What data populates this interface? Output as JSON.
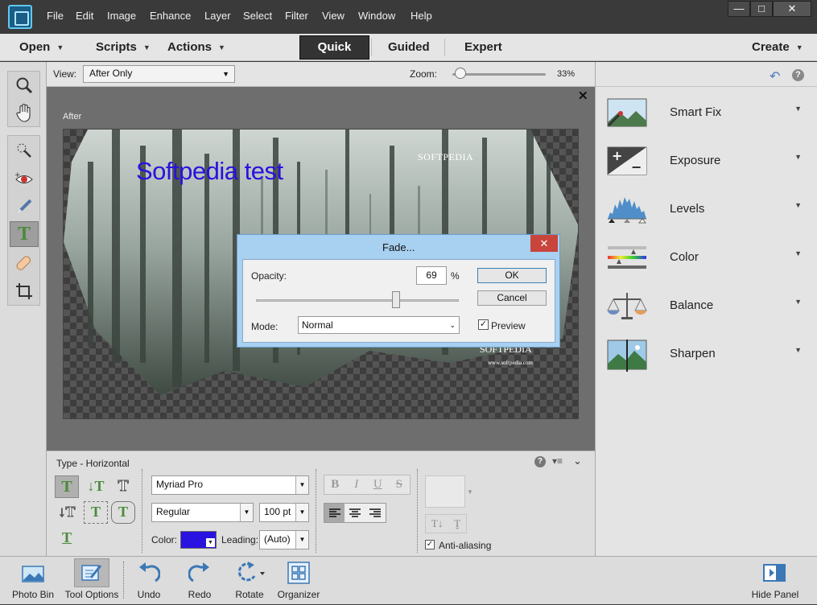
{
  "menu": [
    "File",
    "Edit",
    "Image",
    "Enhance",
    "Layer",
    "Select",
    "Filter",
    "View",
    "Window",
    "Help"
  ],
  "window_controls": {
    "minimize": "—",
    "maximize": "□",
    "close": "✕"
  },
  "modebar": {
    "open": "Open",
    "scripts": "Scripts",
    "actions": "Actions",
    "quick": "Quick",
    "guided": "Guided",
    "expert": "Expert",
    "create": "Create"
  },
  "viewbar": {
    "view_label": "View:",
    "view_value": "After Only",
    "zoom_label": "Zoom:",
    "zoom_value": "33%",
    "zoom_level": 0.33
  },
  "canvas": {
    "after_label": "After",
    "overlay_text": "Softpedia test",
    "watermark_top": "SOFTPEDIA",
    "watermark_bottom": "SOFTPEDIA",
    "watermark_small": "www.softpedia.com",
    "overlay_color": "#2a12e0"
  },
  "dialog": {
    "title": "Fade...",
    "opacity_label": "Opacity:",
    "opacity_value": "69",
    "opacity_unit": "%",
    "opacity_level": 0.69,
    "mode_label": "Mode:",
    "mode_value": "Normal",
    "preview_label": "Preview",
    "preview_checked": true,
    "ok": "OK",
    "cancel": "Cancel",
    "close": "✕"
  },
  "options": {
    "title": "Type - Horizontal",
    "font_family": "Myriad Pro",
    "font_style": "Regular",
    "font_size": "100 pt",
    "color_label": "Color:",
    "color_value": "#2a12e0",
    "leading_label": "Leading:",
    "leading_value": "(Auto)",
    "bold": "B",
    "italic": "I",
    "underline": "U",
    "strike": "S",
    "antialias_label": "Anti-aliasing",
    "antialias_checked": true
  },
  "right_panel": {
    "items": [
      {
        "label": "Smart Fix"
      },
      {
        "label": "Exposure"
      },
      {
        "label": "Levels"
      },
      {
        "label": "Color"
      },
      {
        "label": "Balance"
      },
      {
        "label": "Sharpen"
      }
    ]
  },
  "bottom": {
    "photo_bin": "Photo Bin",
    "tool_options": "Tool Options",
    "undo": "Undo",
    "redo": "Redo",
    "rotate": "Rotate",
    "organizer": "Organizer",
    "hide_panel": "Hide Panel"
  },
  "colors": {
    "accent": "#5fc8f0",
    "dark_bar": "#3a3a3a",
    "panel": "#e4e4e4",
    "dialog_frame": "#a8d0f0",
    "close_red": "#c9453b"
  }
}
